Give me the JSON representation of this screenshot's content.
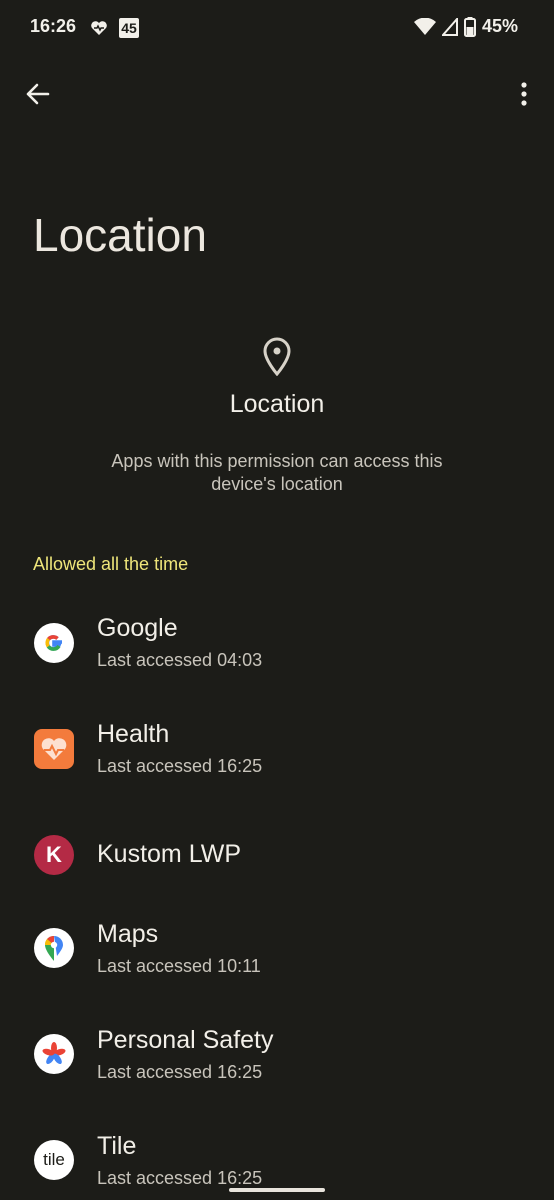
{
  "status_bar": {
    "time": "16:26",
    "badge": "45",
    "battery": "45%"
  },
  "page": {
    "title": "Location"
  },
  "permission": {
    "title": "Location",
    "description": "Apps with this permission can access this device's location"
  },
  "section": {
    "header": "Allowed all the time",
    "header_color": "#eee57a"
  },
  "apps": [
    {
      "name": "Google",
      "subtitle": "Last accessed 04:03",
      "icon": "google-icon"
    },
    {
      "name": "Health",
      "subtitle": "Last accessed 16:25",
      "icon": "health-icon"
    },
    {
      "name": "Kustom LWP",
      "subtitle": "",
      "icon": "kustom-lwp-icon"
    },
    {
      "name": "Maps",
      "subtitle": "Last accessed 10:11",
      "icon": "maps-icon"
    },
    {
      "name": "Personal Safety",
      "subtitle": "Last accessed 16:25",
      "icon": "personal-safety-icon"
    },
    {
      "name": "Tile",
      "subtitle": "Last accessed 16:25",
      "icon": "tile-icon"
    }
  ],
  "tile_logo_text": "tile",
  "kustom_logo_text": "K"
}
